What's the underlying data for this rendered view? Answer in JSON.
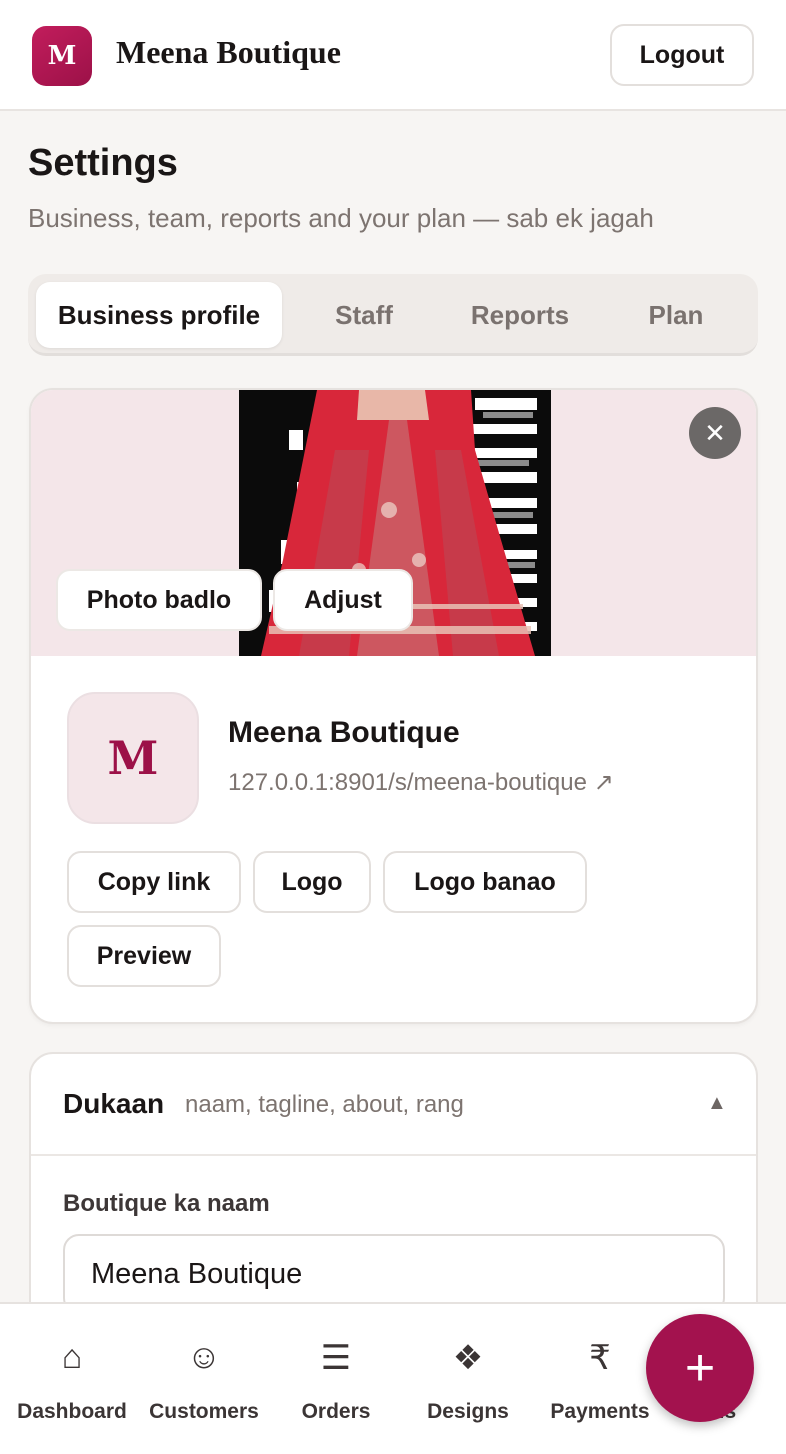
{
  "header": {
    "logo_letter": "M",
    "brand_name": "Meena Boutique",
    "logout_label": "Logout"
  },
  "page": {
    "title": "Settings",
    "subtitle": "Business, team, reports and your plan — sab ek jagah"
  },
  "tabs": [
    {
      "label": "Business profile",
      "active": true
    },
    {
      "label": "Staff",
      "active": false
    },
    {
      "label": "Reports",
      "active": false
    },
    {
      "label": "Plan",
      "active": false
    }
  ],
  "profile_card": {
    "cover_close_icon": "close-icon",
    "close_glyph": "✕",
    "photo_change_label": "Photo badlo",
    "adjust_label": "Adjust",
    "logo_letter": "M",
    "business_name": "Meena Boutique",
    "store_url": "127.0.0.1:8901/s/meena-boutique ↗",
    "actions": [
      {
        "label": "Copy link"
      },
      {
        "label": "Logo"
      },
      {
        "label": "Logo banao"
      },
      {
        "label": "Preview"
      }
    ]
  },
  "dukaan_section": {
    "title": "Dukaan",
    "hint": "naam, tagline, about, rang",
    "caret": "▲",
    "name_field_label": "Boutique ka naam",
    "name_field_value": "Meena Boutique"
  },
  "bottom_nav": {
    "items": [
      {
        "label": "Dashboard",
        "icon": "home-icon",
        "glyph": "⌂"
      },
      {
        "label": "Customers",
        "icon": "smiley-icon",
        "glyph": "☺"
      },
      {
        "label": "Orders",
        "icon": "list-icon",
        "glyph": "☰"
      },
      {
        "label": "Designs",
        "icon": "diamond-icon",
        "glyph": "❖"
      },
      {
        "label": "Payments",
        "icon": "rupee-icon",
        "glyph": "₹"
      },
      {
        "label": "Bills",
        "icon": "bill-icon",
        "glyph": "▤"
      }
    ],
    "fab_glyph": "+"
  },
  "colors": {
    "brand": "#a3124e",
    "cover_bg": "#f4e6e9",
    "page_bg": "#f7f5f3"
  }
}
